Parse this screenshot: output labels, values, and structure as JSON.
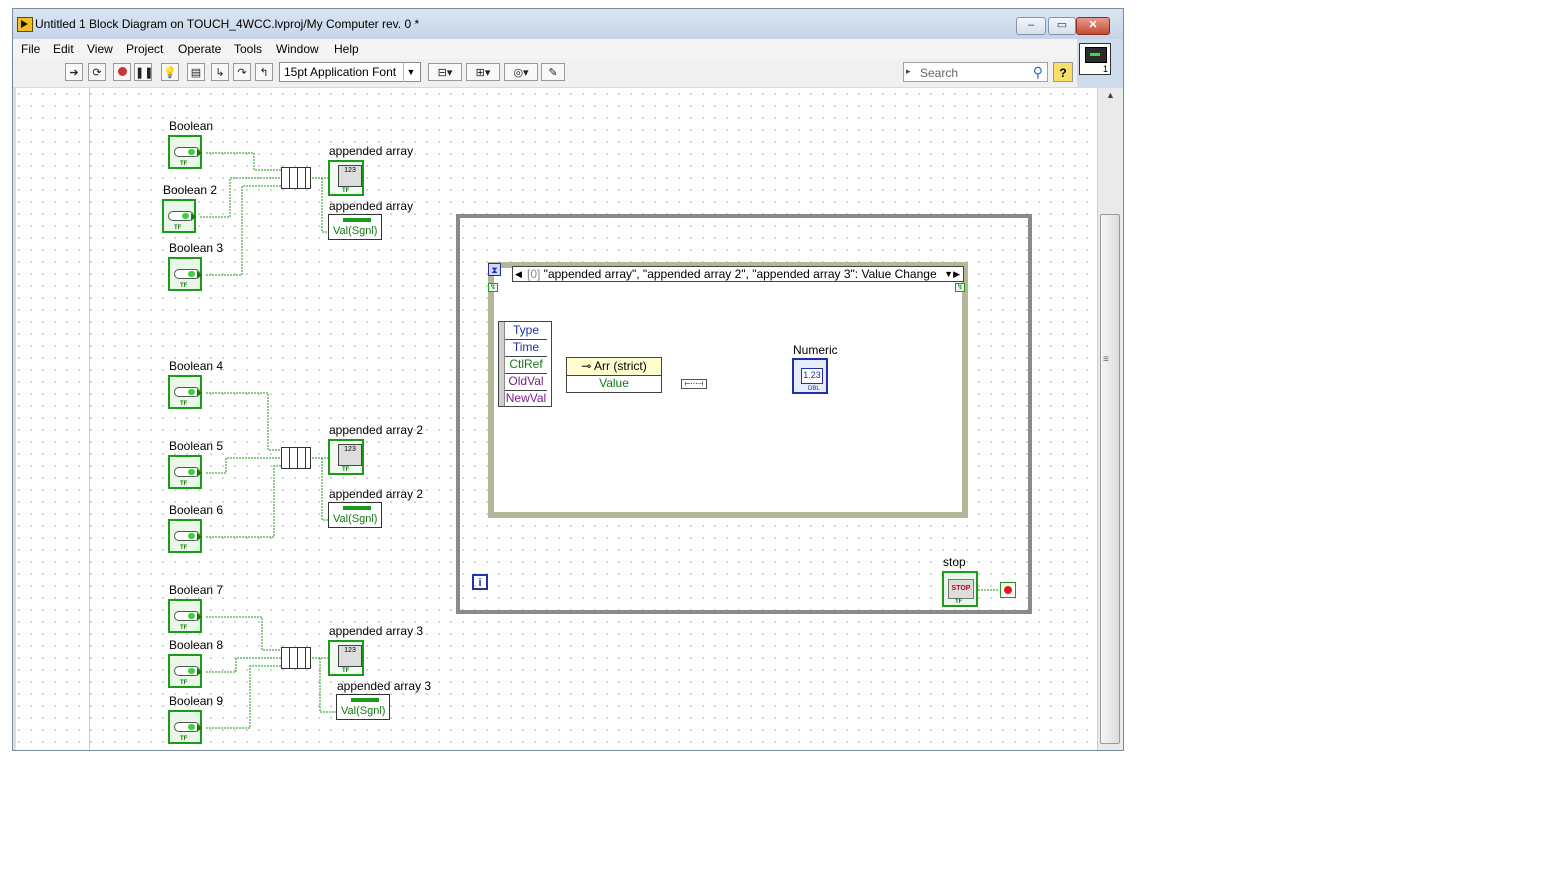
{
  "window": {
    "title": "Untitled 1 Block Diagram on TOUCH_4WCC.lvproj/My Computer rev. 0 *",
    "controls": {
      "minimize": "▭",
      "maximize": "▭",
      "close": "✕"
    }
  },
  "menu": [
    "File",
    "Edit",
    "View",
    "Project",
    "Operate",
    "Tools",
    "Window",
    "Help"
  ],
  "toolbar": {
    "font": "15pt Application Font",
    "search_placeholder": "Search",
    "help": "?"
  },
  "vi_icon_number": "1",
  "diagram": {
    "groups": [
      {
        "booleans": [
          "Boolean",
          "Boolean 2",
          "Boolean 3"
        ],
        "array_label": "appended array",
        "property_label": "appended array",
        "property_value": "Val(Sgnl)"
      },
      {
        "booleans": [
          "Boolean 4",
          "Boolean 5",
          "Boolean 6"
        ],
        "array_label": "appended array 2",
        "property_label": "appended array 2",
        "property_value": "Val(Sgnl)"
      },
      {
        "booleans": [
          "Boolean 7",
          "Boolean 8",
          "Boolean 9"
        ],
        "array_label": "appended array 3",
        "property_label": "appended array 3",
        "property_value": "Val(Sgnl)"
      }
    ],
    "event_structure": {
      "case_index": "[0]",
      "case_label": " \"appended array\", \"appended array 2\", \"appended array 3\": Value Change",
      "event_data": [
        "Type",
        "Time",
        "CtlRef",
        "OldVal",
        "NewVal"
      ],
      "property_node": {
        "class": "Arr (strict)",
        "property": "Value"
      }
    },
    "numeric_label": "Numeric",
    "numeric_glyph": "1.23",
    "array_glyph": "123",
    "stop_label": "stop",
    "stop_glyph": "STOP",
    "loop_iteration": "i",
    "tf_glyph": "TF",
    "dbl_glyph": "DBL"
  },
  "colors": {
    "boolean_wire": "#1a9b1a",
    "numeric_wire": "#1f2fa8",
    "event_data_blue": "#1f2fa8",
    "event_data_purple": "#7a1f8c",
    "stop_condition": "#e21b1b"
  }
}
